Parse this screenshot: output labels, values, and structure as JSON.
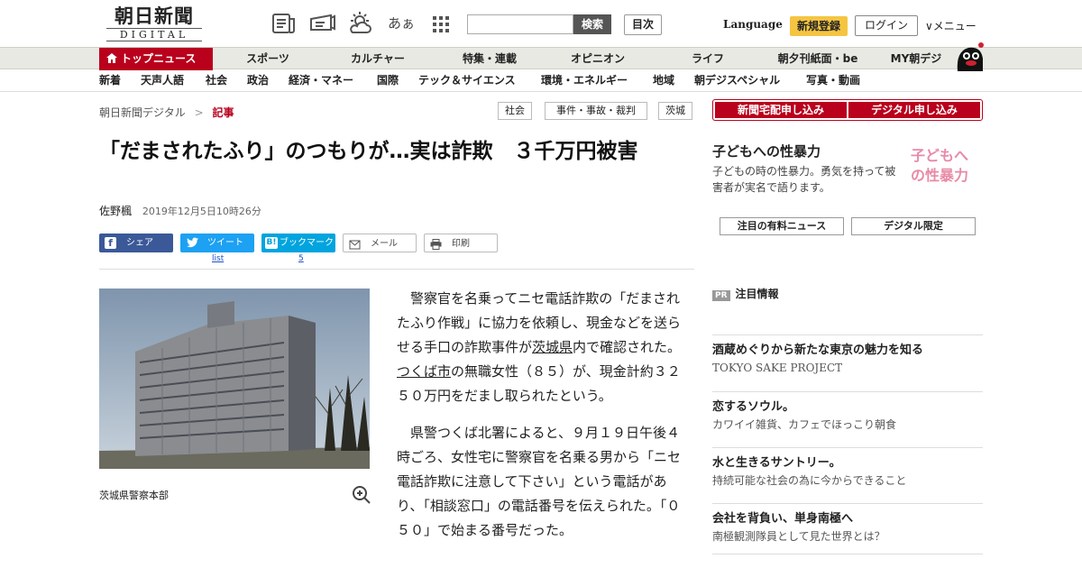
{
  "header": {
    "logo_main": "朝日新聞",
    "logo_sub": "DIGITAL",
    "search_button": "検索",
    "search_placeholder": "",
    "toc_button": "目次",
    "font_size_label": "あぁ",
    "language": "Language",
    "register": "新規登録",
    "login": "ログイン",
    "menu": "∨メニュー"
  },
  "nav_primary": [
    "トップニュース",
    "スポーツ",
    "カルチャー",
    "特集・連載",
    "オピニオン",
    "ライフ",
    "朝夕刊紙面・be",
    "MY朝デジ"
  ],
  "nav_secondary": [
    "新着",
    "天声人語",
    "社会",
    "政治",
    "経済・マネー",
    "国際",
    "テック＆サイエンス",
    "環境・エネルギー",
    "地域",
    "朝デジスペシャル",
    "写真・動画"
  ],
  "breadcrumb": {
    "root": "朝日新聞デジタル",
    "sep": ">",
    "current": "記事"
  },
  "tags": [
    "社会",
    "事件・事故・裁判",
    "茨城"
  ],
  "article": {
    "title": "「だまされたふり」のつもりが…実は詐欺　３千万円被害",
    "author": "佐野楓",
    "datetime": "2019年12月5日10時26分",
    "photo_caption": "茨城県警察本部",
    "p1_a": "警察官を名乗ってニセ電話詐欺の「だまされたふり作戦」に協力を依頼し、現金などを送らせる手口の詐欺事件が",
    "p1_link1": "茨城県",
    "p1_b": "内で確認された。",
    "p1_link2": "つくば市",
    "p1_c": "の無職女性（８５）が、現金計約３２５０万円をだまし取られたという。",
    "p2": "県警つくば北署によると、９月１９日午後４時ごろ、女性宅に警察官を名乗る男から「ニセ電話詐欺に注意して下さい」という電話があり、「相談窓口」の電話番号を伝えられた。「０５０」で始まる番号だった。"
  },
  "share": {
    "facebook": "シェア",
    "twitter": "ツイート",
    "twitter_count": "list",
    "hatena": "ブックマーク",
    "hatena_count": "5",
    "mail": "メール",
    "print": "印刷"
  },
  "sidebar": {
    "btn_paper": "新聞宅配申し込み",
    "btn_digital": "デジタル申し込み",
    "promo_title": "子どもへの性暴力",
    "promo_text": "子どもの時の性暴力。勇気を持って被害者が実名で語ります。",
    "promo_img_text": "子どもへの性暴力",
    "btn_paid_news": "注目の有料ニュース",
    "btn_digital_only": "デジタル限定",
    "pr_badge": "PR",
    "pr_label": "注目情報",
    "items": [
      {
        "title": "酒蔵めぐりから新たな東京の魅力を知る",
        "sub": "TOKYO SAKE PROJECT"
      },
      {
        "title": "恋するソウル。",
        "sub": "カワイイ雑貨、カフェでほっこり朝食"
      },
      {
        "title": "水と生きるサントリー。",
        "sub": "持続可能な社会の為に今からできること"
      },
      {
        "title": "会社を背負い、単身南極へ",
        "sub": "南極観測隊員として見た世界とは？"
      }
    ]
  },
  "colors": {
    "brand_red": "#b9001c",
    "register_yellow": "#f5c542",
    "facebook": "#3b5998",
    "twitter": "#1da1f2",
    "hatena": "#00a4de"
  }
}
